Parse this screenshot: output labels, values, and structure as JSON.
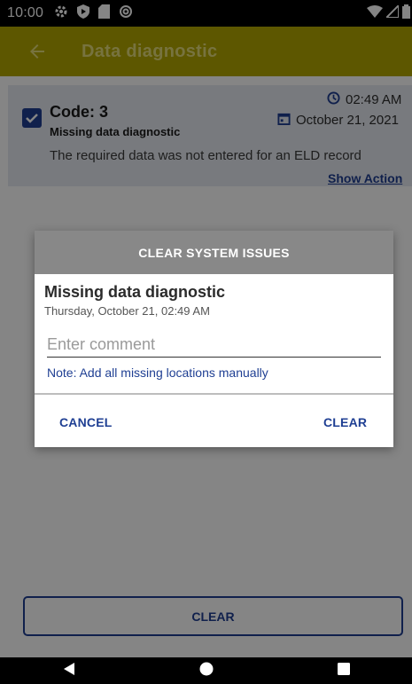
{
  "status_bar": {
    "time": "10:00",
    "icons": [
      "settings-icon",
      "shield-icon",
      "sd-card-icon",
      "at-icon",
      "wifi-icon",
      "signal-icon",
      "battery-icon"
    ]
  },
  "app_bar": {
    "back_icon": "arrow-left-icon",
    "title": "Data diagnostic"
  },
  "diagnostic_card": {
    "checked": true,
    "code": "Code: 3",
    "name": "Missing data diagnostic",
    "description": "The required data was not entered for an ELD record",
    "time": "02:49 AM",
    "date": "October 21, 2021",
    "show_action_label": "Show Action"
  },
  "bottom_button": {
    "label": "CLEAR"
  },
  "dialog": {
    "header": "CLEAR SYSTEM ISSUES",
    "title": "Missing data diagnostic",
    "subtitle": "Thursday, October 21, 02:49 AM",
    "comment_value": "",
    "comment_placeholder": "Enter comment",
    "note": "Note: Add all missing locations manually",
    "cancel_label": "CANCEL",
    "clear_label": "CLEAR"
  },
  "colors": {
    "app_bar": "#b3a700",
    "accent": "#1f3f93",
    "dialog_header": "#888888"
  }
}
